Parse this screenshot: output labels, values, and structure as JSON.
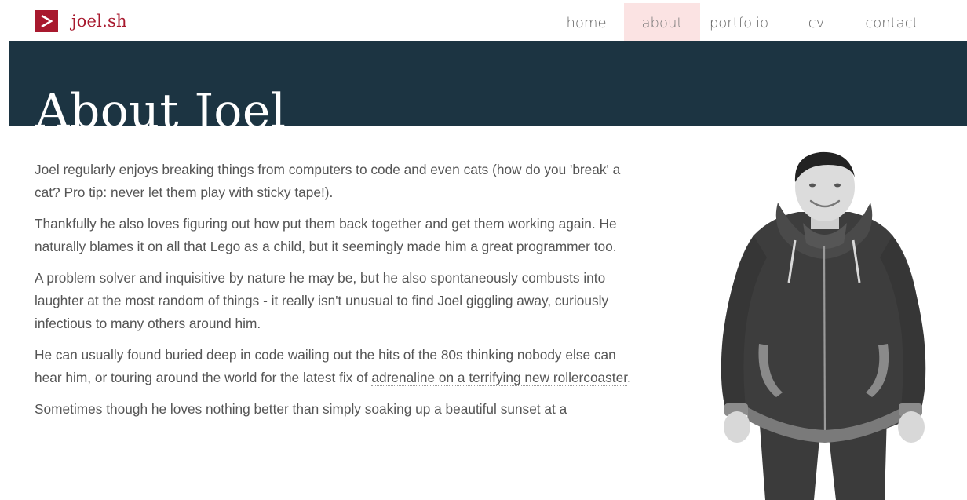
{
  "brand": {
    "logo_icon": "chevron-right-icon",
    "name": "joel.sh",
    "accent_color": "#a8192e"
  },
  "nav": {
    "items": [
      {
        "label": "home",
        "active": false
      },
      {
        "label": "about",
        "active": true
      },
      {
        "label": "portfolio",
        "active": false
      },
      {
        "label": "cv",
        "active": false
      },
      {
        "label": "contact",
        "active": false
      }
    ],
    "active_bg": "#fbe3e3"
  },
  "hero": {
    "title": "About Joel",
    "bg_color": "#1c3442"
  },
  "content": {
    "p1": "Joel regularly enjoys breaking things from computers to code and even cats (how do you 'break' a cat? Pro tip: never let them play with sticky tape!).",
    "p2": "Thankfully he also loves figuring out how put them back together and get them working again. He naturally blames it on all that Lego as a child, but it seemingly made him a great programmer too.",
    "p3": "A problem solver and inquisitive by nature he may be, but he also spontaneously combusts into laughter at the most random of things - it really isn't unusual to find Joel giggling away, curiously infectious to many others around him.",
    "p4_a": "He can usually found buried deep in code ",
    "p4_link1": "wailing out the hits of the 80s",
    "p4_b": " thinking nobody else can hear him, or touring around the world for the latest fix of ",
    "p4_link2": "adrenaline on a terrifying new rollercoaster",
    "p4_c": ".",
    "p5": "Sometimes though he loves nothing better than simply soaking up a beautiful sunset at a"
  },
  "portrait": {
    "subject": "person-photo"
  }
}
